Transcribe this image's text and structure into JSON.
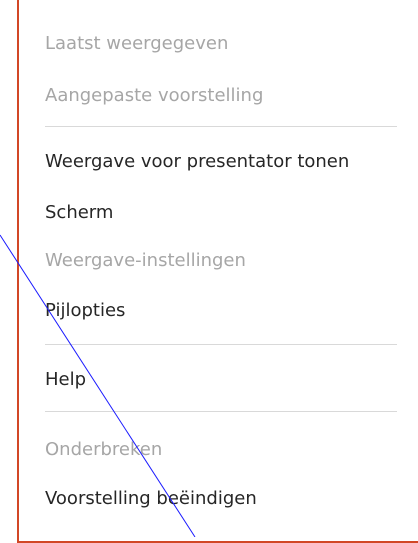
{
  "menu": {
    "items": [
      {
        "label": "Laatst weergegeven",
        "disabled": true,
        "submenu": false
      },
      {
        "label": "Aangepaste voorstelling",
        "disabled": true,
        "submenu": true
      },
      {
        "label": "Weergave voor presentator tonen",
        "disabled": false,
        "submenu": false
      },
      {
        "label": "Scherm",
        "disabled": false,
        "submenu": true
      },
      {
        "label": "Weergave-instellingen",
        "disabled": true,
        "submenu": true
      },
      {
        "label": "Pijlopties",
        "disabled": false,
        "submenu": true
      },
      {
        "label": "Help",
        "disabled": false,
        "submenu": false
      },
      {
        "label": "Onderbreken",
        "disabled": true,
        "submenu": false
      },
      {
        "label": "Voorstelling beëindigen",
        "disabled": false,
        "submenu": false
      }
    ]
  },
  "colors": {
    "border": "#d24726",
    "text": "#262626",
    "disabled_text": "#a6a6a6",
    "separator": "#d9d9d9",
    "pen_stroke": "#1a1aff"
  }
}
